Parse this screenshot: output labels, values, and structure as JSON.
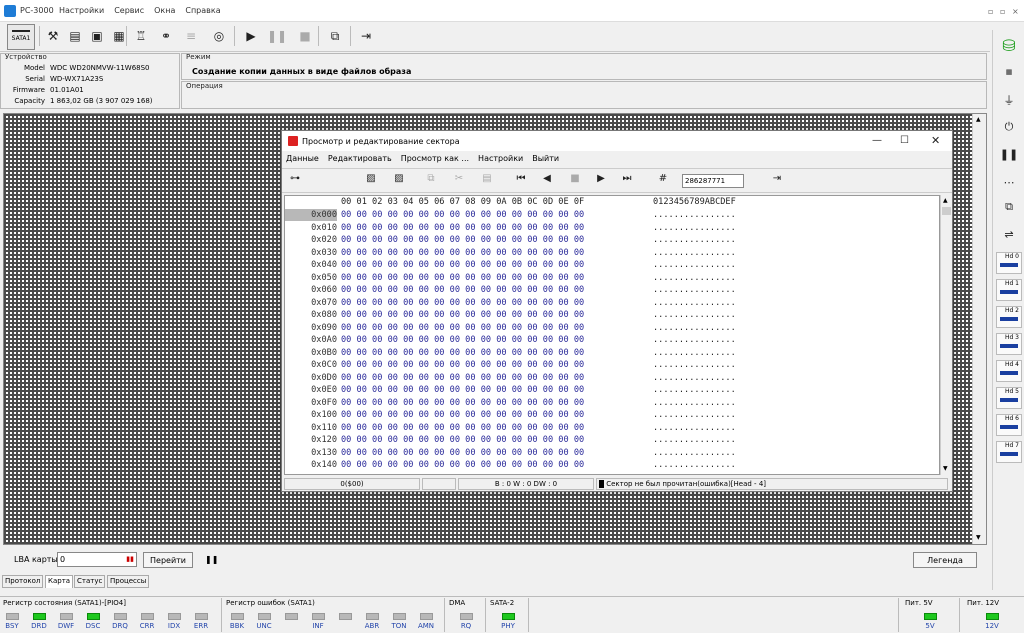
{
  "app": {
    "title": "PC-3000",
    "menu": [
      "Настройки",
      "Сервис",
      "Окна",
      "Справка"
    ]
  },
  "toolbar": {
    "sata_label": "SATA1"
  },
  "device": {
    "group_label": "Устройство",
    "fields": [
      {
        "key": "Model",
        "value": "WDC WD20NMVW-11W68S0"
      },
      {
        "key": "Serial",
        "value": "WD-WX71A23S"
      },
      {
        "key": "Firmware",
        "value": "01.01A01"
      },
      {
        "key": "Capacity",
        "value": "1 863,02 GB (3 907 029 168)"
      }
    ]
  },
  "mode": {
    "group_label": "Режим",
    "value": "Создание копии данных в виде файлов образа"
  },
  "operation": {
    "group_label": "Операция"
  },
  "dialog": {
    "title": "Просмотр и редактирование сектора",
    "menu": [
      "Данные",
      "Редактировать",
      "Просмотр как ...",
      "Настройки",
      "Выйти"
    ],
    "sector_input": "286287771",
    "hex_header": "00 01 02 03 04 05 06 07 08 09 0A 0B 0C 0D 0E 0F",
    "ascii_header": "0123456789ABCDEF",
    "rows": [
      "0x000",
      "0x010",
      "0x020",
      "0x030",
      "0x040",
      "0x050",
      "0x060",
      "0x070",
      "0x080",
      "0x090",
      "0x0A0",
      "0x0B0",
      "0x0C0",
      "0x0D0",
      "0x0E0",
      "0x0F0",
      "0x100",
      "0x110",
      "0x120",
      "0x130",
      "0x140"
    ],
    "row_bytes": "00 00 00 00 00 00 00 00 00 00 00 00 00 00 00 00",
    "row_ascii": "................",
    "status": {
      "offset": "0($00)",
      "bw": "B : 0 W : 0 DW : 0",
      "message": "Сектор не был прочитан(ошибка)[Head - 4]"
    }
  },
  "bottom": {
    "lba_label": "LBA карты",
    "lba_value": "0",
    "goto_button": "Перейти",
    "legend_button": "Легенда",
    "tabs": [
      "Протокол",
      "Карта",
      "Статус",
      "Процессы"
    ],
    "active_tab": "Карта"
  },
  "status_register": {
    "label": "Регистр состояния (SATA1)-[PIO4]",
    "leds": [
      {
        "name": "BSY",
        "on": false
      },
      {
        "name": "DRD",
        "on": true
      },
      {
        "name": "DWF",
        "on": false
      },
      {
        "name": "DSC",
        "on": true
      },
      {
        "name": "DRQ",
        "on": false
      },
      {
        "name": "CRR",
        "on": false
      },
      {
        "name": "IDX",
        "on": false
      },
      {
        "name": "ERR",
        "on": false
      }
    ]
  },
  "error_register": {
    "label": "Регистр ошибок (SATA1)",
    "leds": [
      {
        "name": "BBK",
        "on": false
      },
      {
        "name": "UNC",
        "on": false
      },
      {
        "name": "",
        "on": false
      },
      {
        "name": "INF",
        "on": false
      },
      {
        "name": "",
        "on": false
      },
      {
        "name": "ABR",
        "on": false
      },
      {
        "name": "TON",
        "on": false
      },
      {
        "name": "AMN",
        "on": false
      }
    ]
  },
  "dma": {
    "label": "DMA",
    "led": "RQ",
    "on": false
  },
  "sata2": {
    "label": "SATA-2",
    "led": "PHY",
    "on": true
  },
  "power": [
    {
      "label": "Пит. 5V",
      "led": "5V",
      "on": true
    },
    {
      "label": "Пит. 12V",
      "led": "12V",
      "on": true
    }
  ],
  "heads": [
    "Hd 0",
    "Hd 1",
    "Hd 2",
    "Hd 3",
    "Hd 4",
    "Hd 5",
    "Hd 6",
    "Hd 7"
  ]
}
